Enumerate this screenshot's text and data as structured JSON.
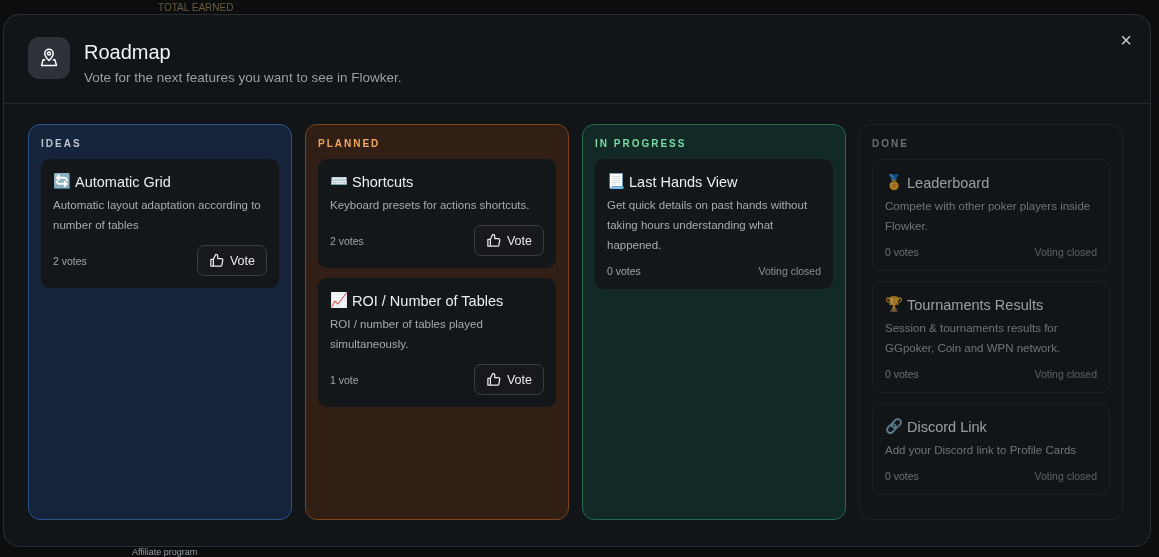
{
  "background": {
    "top_text": "TOTAL EARNED",
    "bottom_text": "Affiliate program"
  },
  "modal": {
    "title": "Roadmap",
    "subtitle": "Vote for the next features you want to see in Flowker.",
    "close": "×"
  },
  "columns": [
    {
      "kind": "ideas",
      "title": "IDEAS",
      "items": [
        {
          "icon": "🔄",
          "title": "Automatic Grid",
          "description": "Automatic layout adaptation according to number of tables",
          "votes": "2 votes",
          "action": {
            "kind": "button",
            "label": "Vote"
          }
        }
      ]
    },
    {
      "kind": "planned",
      "title": "PLANNED",
      "items": [
        {
          "icon": "⌨️",
          "title": "Shortcuts",
          "description": "Keyboard presets for actions shortcuts.",
          "votes": "2 votes",
          "action": {
            "kind": "button",
            "label": "Vote"
          }
        },
        {
          "icon": "📈",
          "title": "ROI / Number of Tables",
          "description": "ROI / number of tables played simultaneously.",
          "votes": "1 vote",
          "action": {
            "kind": "button",
            "label": "Vote"
          }
        }
      ]
    },
    {
      "kind": "in_progress",
      "title": "IN PROGRESS",
      "items": [
        {
          "icon": "📃",
          "title": "Last Hands View",
          "description": "Get quick details on past hands without taking hours understanding what happened.",
          "votes": "0 votes",
          "action": {
            "kind": "status",
            "label": "Voting closed"
          }
        }
      ]
    },
    {
      "kind": "done",
      "title": "DONE",
      "items": [
        {
          "icon": "🏅",
          "title": "Leaderboard",
          "description": "Compete with other poker players inside Flowker.",
          "votes": "0 votes",
          "action": {
            "kind": "status",
            "label": "Voting closed"
          }
        },
        {
          "icon": "🏆",
          "title": "Tournaments Results",
          "description": "Session & tournaments results for GGpoker, Coin and WPN network.",
          "votes": "0 votes",
          "action": {
            "kind": "status",
            "label": "Voting closed"
          }
        },
        {
          "icon": "🔗",
          "title": "Discord Link",
          "description": "Add your Discord link to Profile Cards",
          "votes": "0 votes",
          "action": {
            "kind": "status",
            "label": "Voting closed"
          }
        }
      ]
    }
  ]
}
